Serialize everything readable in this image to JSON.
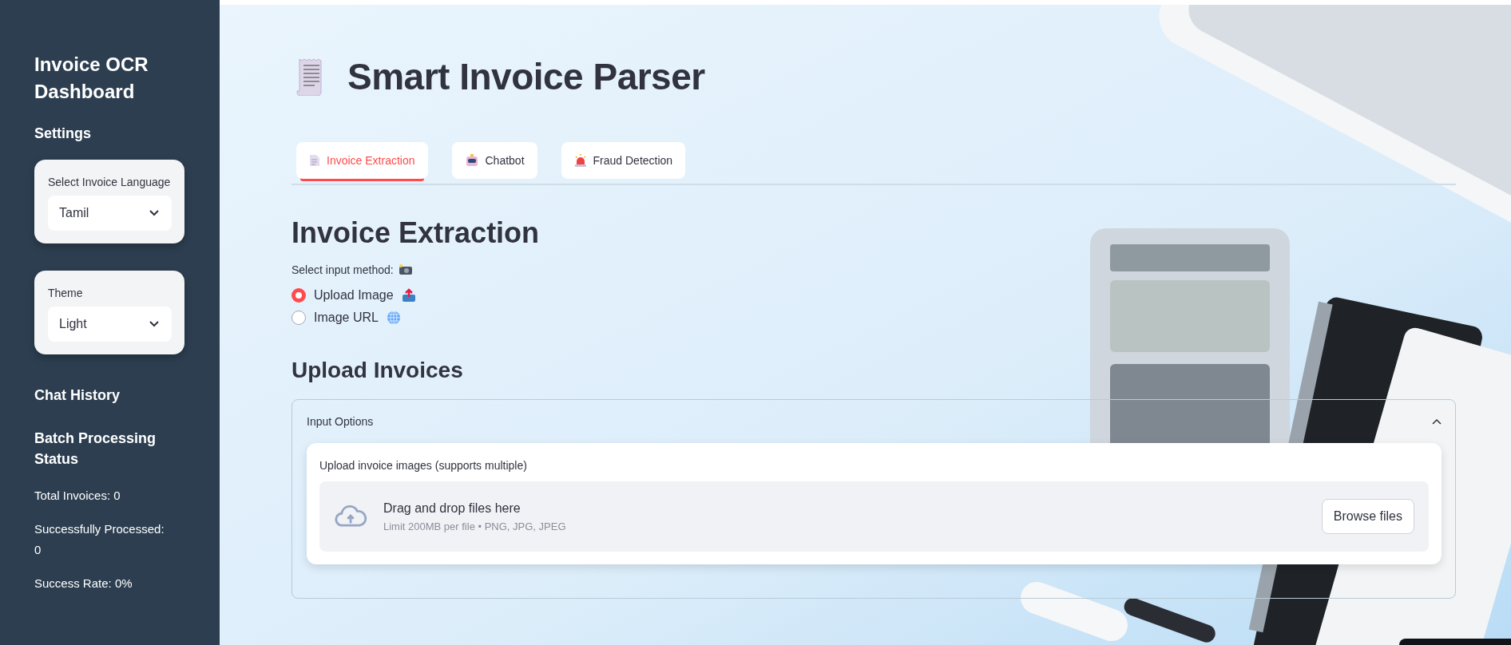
{
  "sidebar": {
    "title": "Invoice OCR Dashboard",
    "settings_heading": "Settings",
    "selects": [
      {
        "label": "Select Invoice Language",
        "value": "Tamil"
      },
      {
        "label": "Theme",
        "value": "Light"
      }
    ],
    "chat_heading": "Chat History",
    "batch_heading": "Batch Processing Status",
    "stats": [
      "Total Invoices: 0",
      "Successfully Processed: 0",
      "Success Rate: 0%"
    ]
  },
  "page": {
    "title": "Smart Invoice Parser"
  },
  "tabs": [
    {
      "label": "Invoice Extraction",
      "selected": true,
      "kind": "document"
    },
    {
      "label": "Chatbot",
      "selected": false,
      "kind": "robot"
    },
    {
      "label": "Fraud Detection",
      "selected": false,
      "kind": "siren"
    }
  ],
  "section_title": "Invoice Extraction",
  "input_method": {
    "label": "Select input method:",
    "options": [
      {
        "label": "Upload Image",
        "selected": true,
        "kind": "upload"
      },
      {
        "label": "Image URL",
        "selected": false,
        "kind": "globe"
      }
    ]
  },
  "upload_heading": "Upload Invoices",
  "expander": {
    "label": "Input Options",
    "expanded": true
  },
  "uploader": {
    "label": "Upload invoice images (supports multiple)",
    "drop_text": "Drag and drop files here",
    "limits": "Limit 200MB per file • PNG, JPG, JPEG",
    "button": "Browse files"
  }
}
